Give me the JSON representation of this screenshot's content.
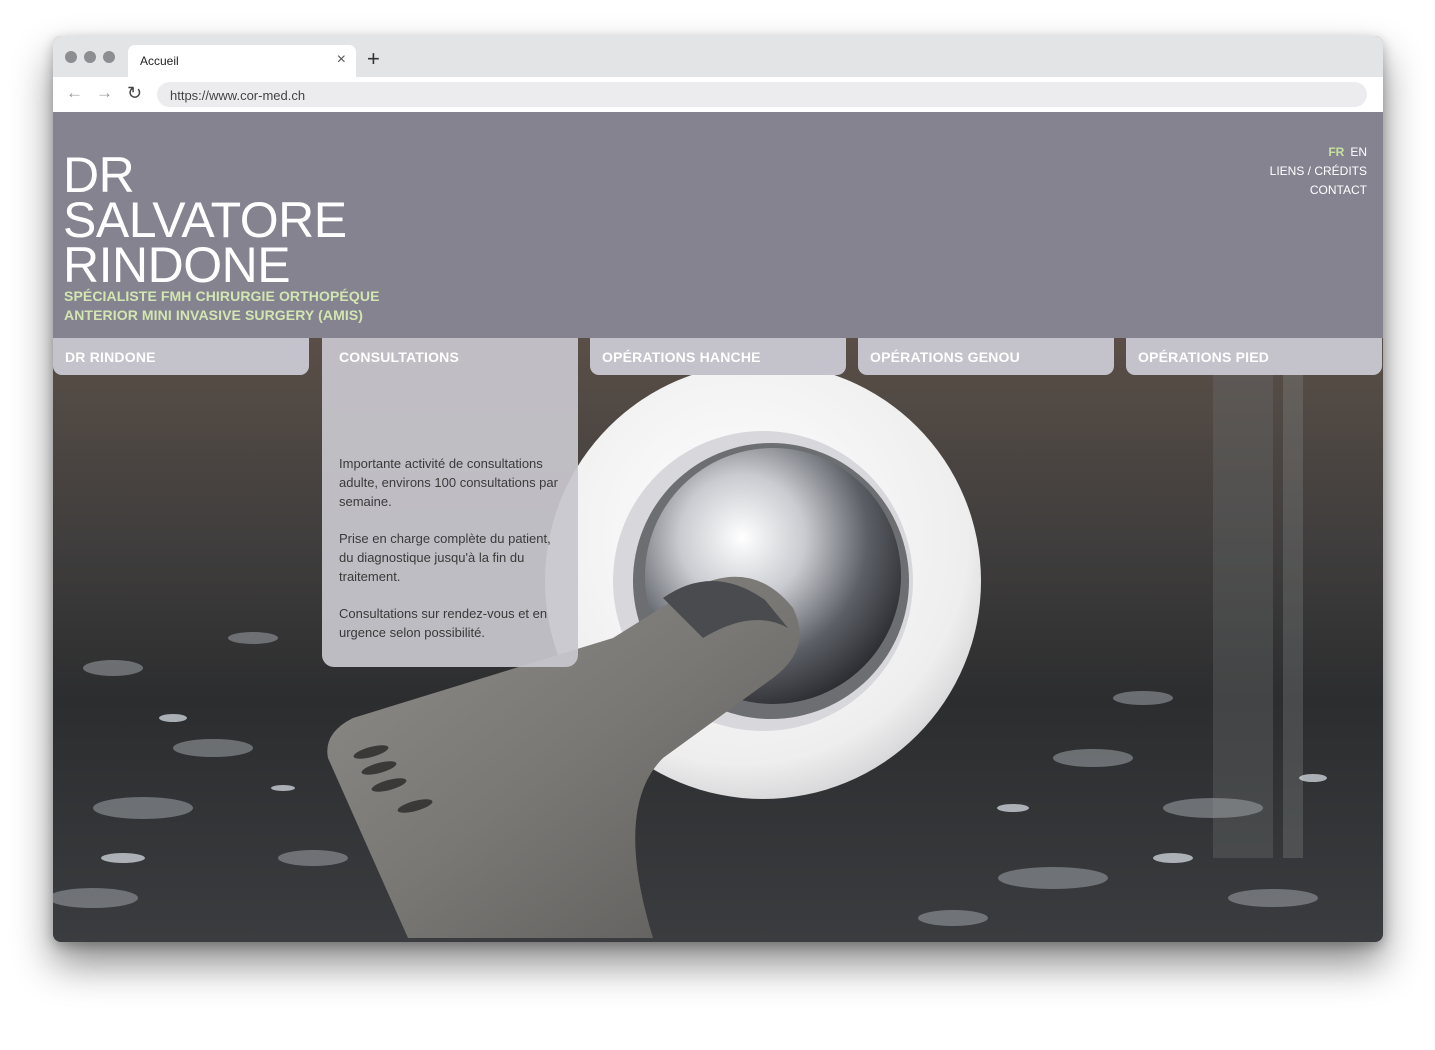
{
  "browser": {
    "tab_title": "Accueil",
    "tab_close": "×",
    "new_tab": "+",
    "url": "https://www.cor-med.ch",
    "back": "←",
    "forward": "→",
    "reload": "↻"
  },
  "header": {
    "name_line1": "DR",
    "name_line2": "SALVATORE",
    "name_line3": "RINDONE",
    "subtitle_line1": "SPÉCIALISTE FMH CHIRURGIE ORTHOPÉQUE",
    "subtitle_line2": "ANTERIOR MINI INVASIVE SURGERY (AMIS)"
  },
  "topnav": {
    "lang_fr": "FR",
    "lang_en": "EN",
    "links": "LIENS / CRÉDITS",
    "contact": "CONTACT"
  },
  "menu": {
    "items": [
      {
        "label": "DR RINDONE"
      },
      {
        "label": "CONSULTATIONS"
      },
      {
        "label": "OPÉRATIONS HANCHE"
      },
      {
        "label": "OPÉRATIONS GENOU"
      },
      {
        "label": "OPÉRATIONS PIED"
      }
    ],
    "active_index": 1
  },
  "consultations_panel": {
    "paragraphs": [
      "Importante activité de consultations adulte, environs 100 consultations par semaine.",
      "Prise en charge complète du patient, du diagnostique jusqu'à la fin du traitement.",
      "Consultations sur rendez-vous et en urgence selon possibilité."
    ]
  },
  "colors": {
    "header_bg": "#858390",
    "accent_green": "#d2e6b2",
    "menu_tab": "#c4c3cb"
  },
  "hero_image": {
    "icon": "hip-prosthesis-image"
  }
}
